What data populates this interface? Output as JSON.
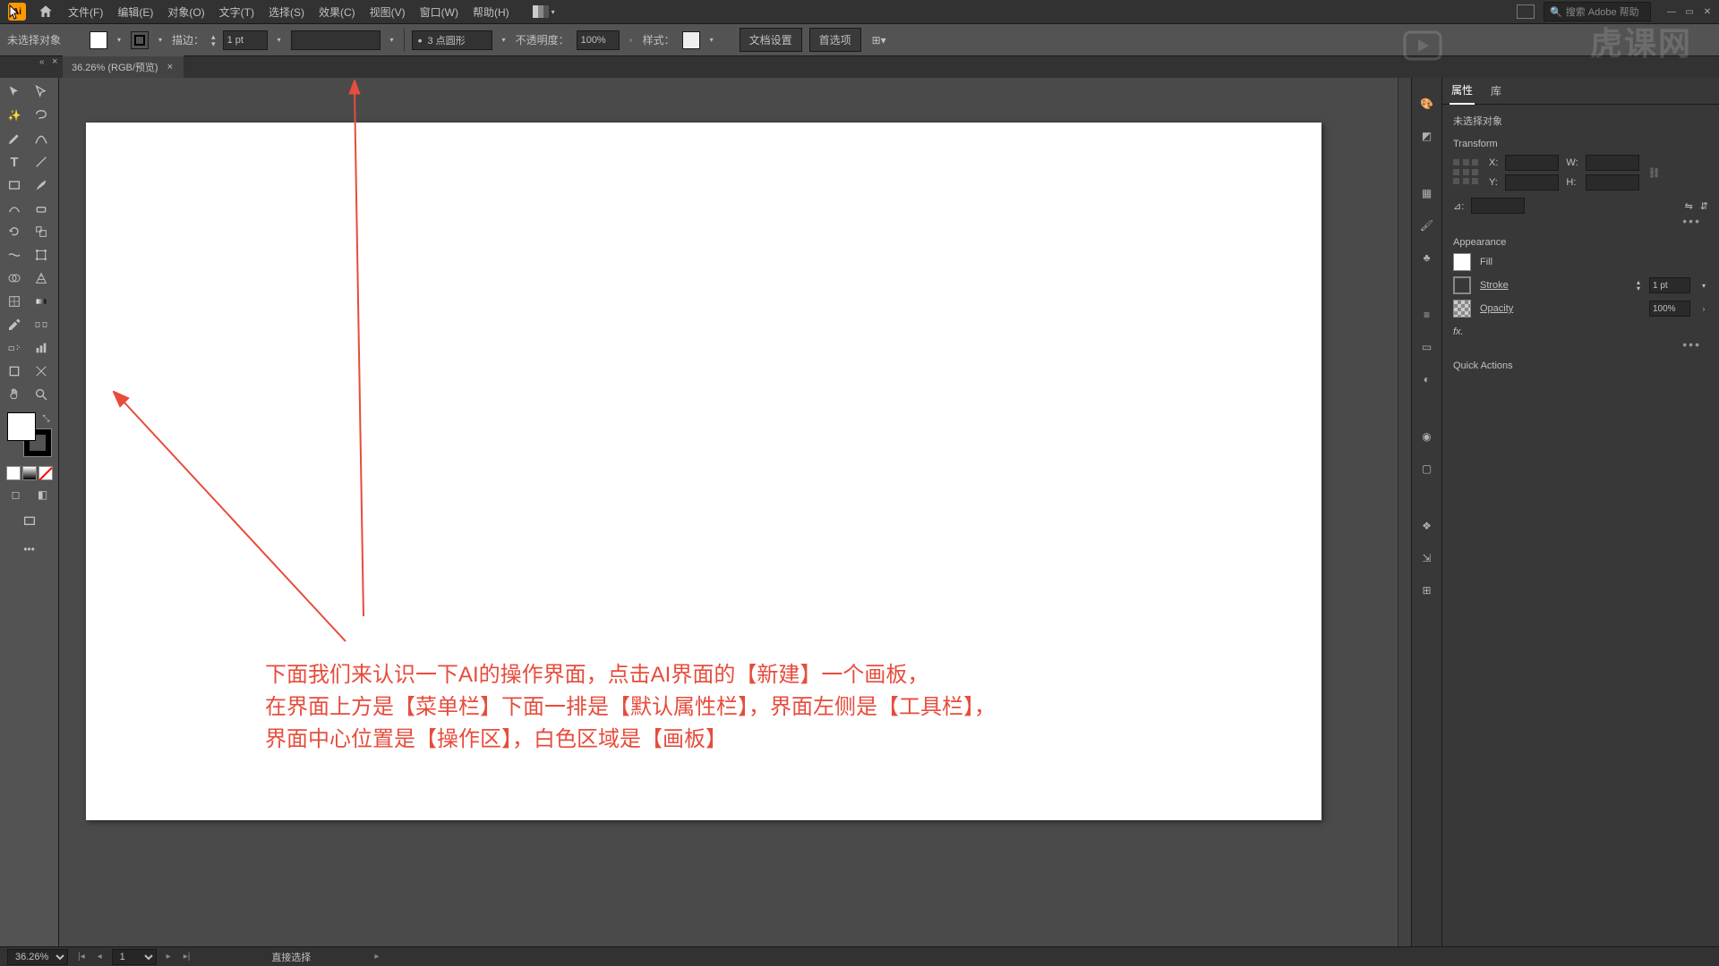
{
  "menubar": {
    "items": [
      "文件(F)",
      "编辑(E)",
      "对象(O)",
      "文字(T)",
      "选择(S)",
      "效果(C)",
      "视图(V)",
      "窗口(W)",
      "帮助(H)"
    ],
    "search_placeholder": "搜索 Adobe 帮助"
  },
  "controlbar": {
    "selection_label": "未选择对象",
    "stroke_label": "描边：",
    "stroke_value": "1 pt",
    "brush_value": "3 点圆形",
    "opacity_label": "不透明度：",
    "opacity_value": "100%",
    "style_label": "样式：",
    "doc_setup": "文档设置",
    "prefs": "首选项"
  },
  "tab": {
    "title": "36.26% (RGB/预览)"
  },
  "panels": {
    "tabs": [
      "属性",
      "库"
    ],
    "no_selection": "未选择对象",
    "transform_label": "Transform",
    "x_label": "X:",
    "y_label": "Y:",
    "w_label": "W:",
    "h_label": "H:",
    "angle_label": "⊿:",
    "appearance_label": "Appearance",
    "fill_label": "Fill",
    "stroke_label": "Stroke",
    "stroke_value": "1 pt",
    "opacity_label": "Opacity",
    "opacity_value": "100%",
    "fx_label": "fx.",
    "quick_actions": "Quick Actions"
  },
  "status": {
    "zoom": "36.26%",
    "artboard": "1",
    "tool": "直接选择"
  },
  "annotation": {
    "line1": "下面我们来认识一下AI的操作界面，点击AI界面的【新建】一个画板，",
    "line2": "在界面上方是【菜单栏】下面一排是【默认属性栏】，界面左侧是【工具栏】，",
    "line3": "界面中心位置是【操作区】，白色区域是【画板】"
  },
  "watermark": "虎课网",
  "colors": {
    "accent": "#ff9a00",
    "annot": "#e74c3c"
  }
}
